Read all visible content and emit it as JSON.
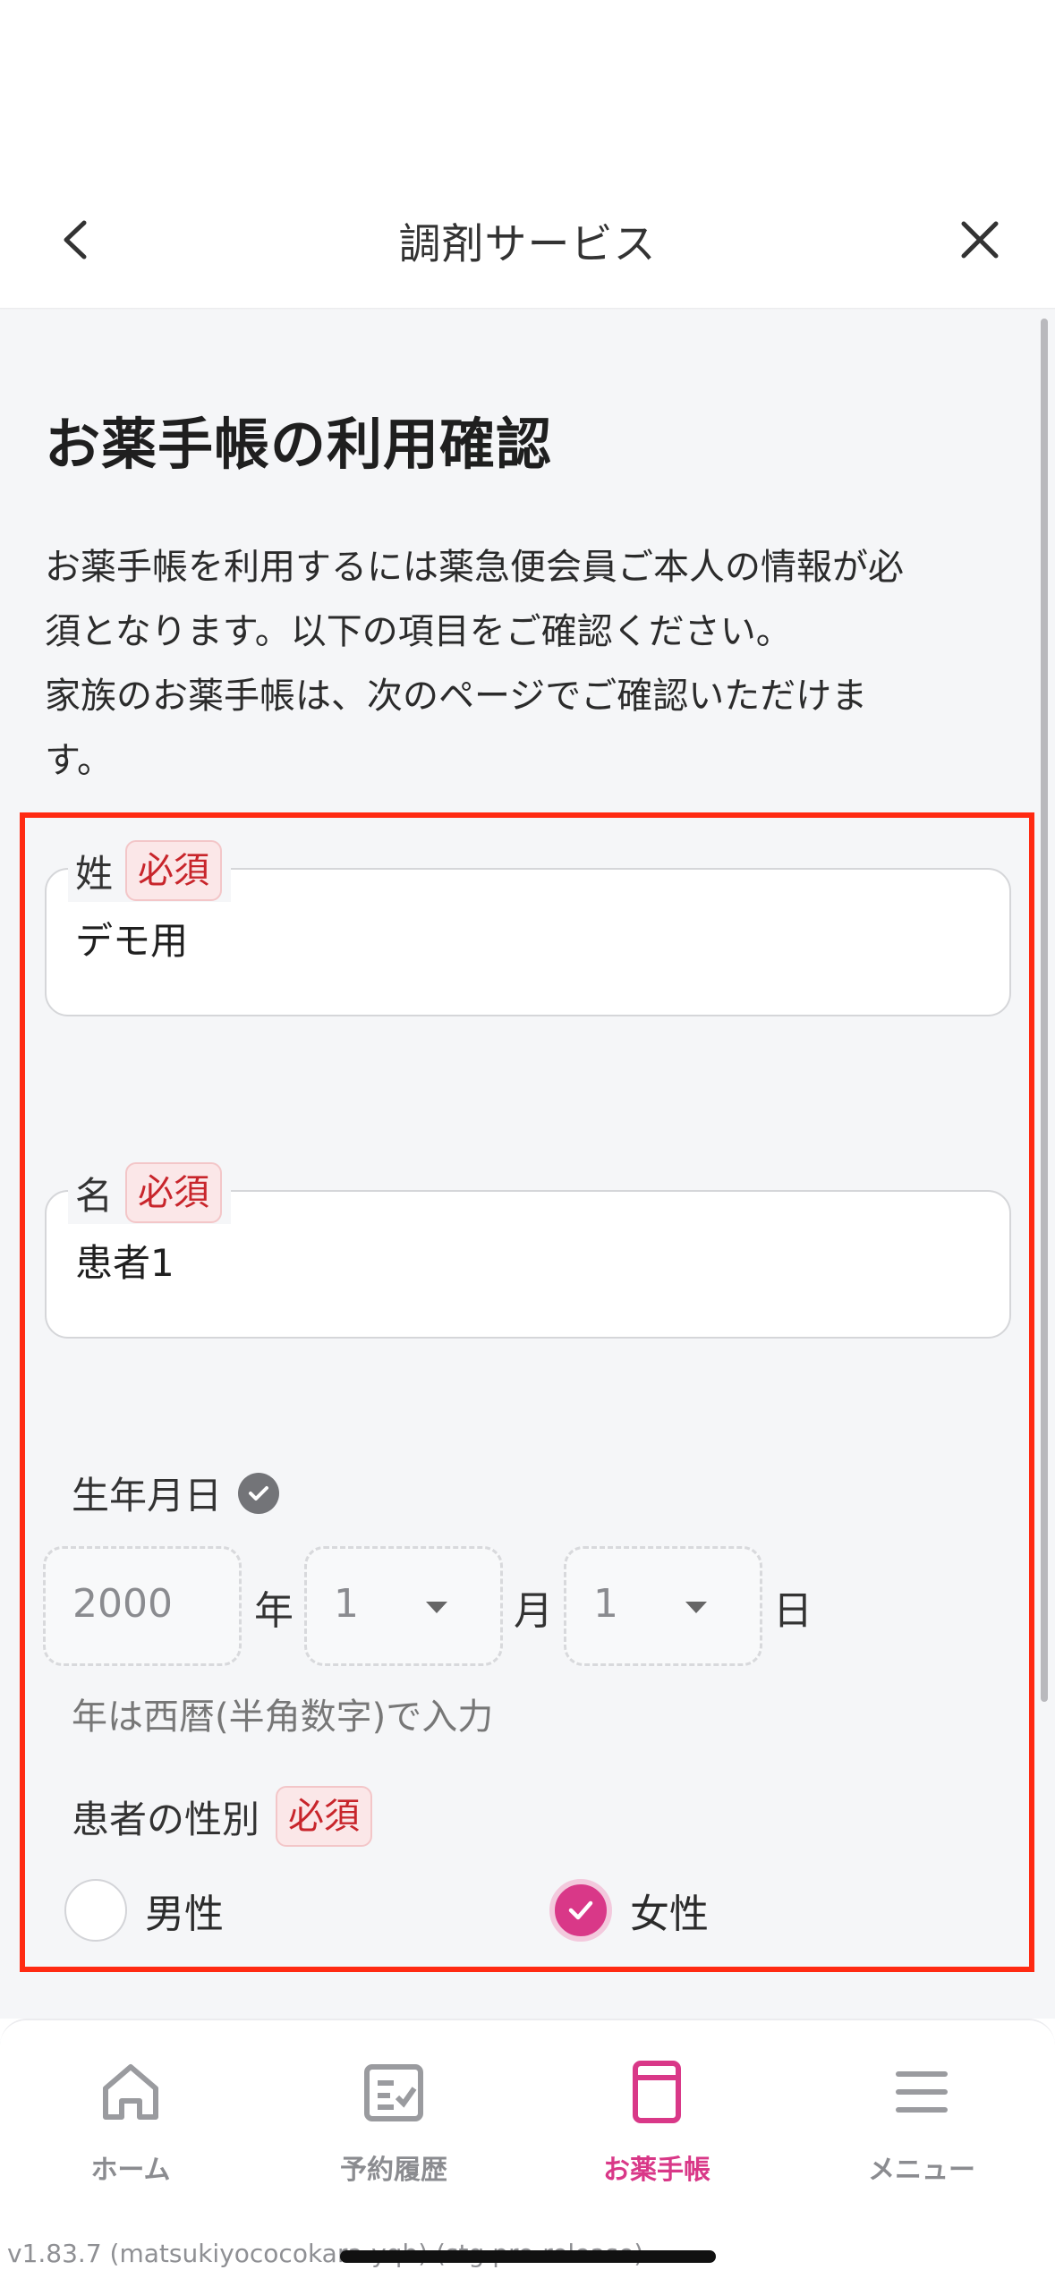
{
  "header": {
    "title": "調剤サービス"
  },
  "page": {
    "title": "お薬手帳の利用確認",
    "description_lines": [
      "お薬手帳を利用するには薬急便会員ご本人の情報が必",
      "須となります。以下の項目をご確認ください。",
      "家族のお薬手帳は、次のページでご確認いただけま",
      "す。"
    ]
  },
  "form": {
    "required_label": "必須",
    "last_name": {
      "label": "姓",
      "value": "デモ用"
    },
    "first_name": {
      "label": "名",
      "value": "患者1"
    },
    "birthdate": {
      "label": "生年月日",
      "year": "2000",
      "year_unit": "年",
      "month": "1",
      "month_unit": "月",
      "day": "1",
      "day_unit": "日",
      "hint": "年は西暦(半角数字)で入力"
    },
    "gender": {
      "label": "患者の性別",
      "options": [
        {
          "label": "男性",
          "selected": false
        },
        {
          "label": "女性",
          "selected": true
        }
      ]
    }
  },
  "tabbar": {
    "items": [
      {
        "label": "ホーム",
        "icon": "home-icon",
        "active": false
      },
      {
        "label": "予約履歴",
        "icon": "history-icon",
        "active": false
      },
      {
        "label": "お薬手帳",
        "icon": "notebook-icon",
        "active": true
      },
      {
        "label": "メニュー",
        "icon": "menu-icon",
        "active": false
      }
    ]
  },
  "footer": {
    "version": "v1.83.7 (matsukiyococokara-yqb) (stg.pre-release)"
  },
  "colors": {
    "accent": "#d93888",
    "required": "#c8252b",
    "highlight": "#ff2a12",
    "background": "#f5f6f8"
  }
}
